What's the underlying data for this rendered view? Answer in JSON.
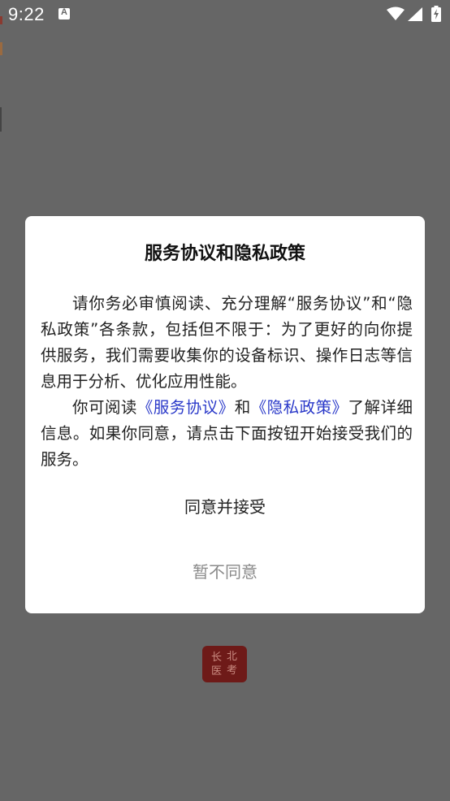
{
  "status_bar": {
    "time": "9:22",
    "notification_icon": "font-a-icon",
    "wifi_icon": "wifi-icon",
    "signal_icon": "cell-signal-icon",
    "battery_icon": "battery-charging-icon"
  },
  "dialog": {
    "title": "服务协议和隐私政策",
    "paragraph1": "请你务必审慎阅读、充分理解“服务协议”和“隐私政策”各条款，包括但不限于：为了更好的向你提供服务，我们需要收集你的设备标识、操作日志等信息用于分析、优化应用性能。",
    "paragraph2": {
      "prefix": "你可阅读",
      "link_service": "《服务协议》",
      "and": "和",
      "link_privacy": "《隐私政策》",
      "suffix": "了解详细信息。如果你同意，请点击下面按钮开始接受我们的服务。"
    },
    "agree_label": "同意并接受",
    "disagree_label": "暂不同意"
  },
  "logo": {
    "chars": [
      "北",
      "长",
      "考",
      "医"
    ],
    "background_color": "#6e1a18"
  },
  "colors": {
    "overlay": "#666666",
    "link": "#2a39c9"
  }
}
